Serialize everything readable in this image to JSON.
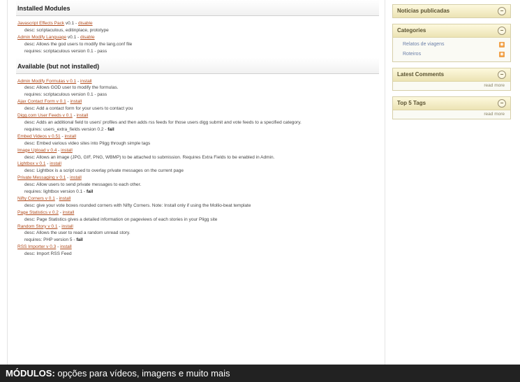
{
  "installed": {
    "heading": "Installed Modules",
    "modules": [
      {
        "name": "Javascript Effects Pack",
        "version": "v0.1",
        "action": "disable",
        "lines": [
          "desc: scriptaculous, editinplace, prototype"
        ]
      },
      {
        "name": "Admin Modify Language",
        "version": "v0.1",
        "action": "disable",
        "lines": [
          "desc: Allows the god users to modify the lang.conf file",
          "requires: scriptaculous version 0.1 - pass"
        ]
      }
    ]
  },
  "available": {
    "heading": "Available (but not installed)",
    "modules": [
      {
        "name": "Admin Modify Formulas v 0.1",
        "action": "install",
        "lines": [
          "desc: Allows GOD user to modify the formulas.",
          "requires: scriptaculous version 0.1 - pass"
        ]
      },
      {
        "name": "Ajax Contact Form v 0.1",
        "action": "install",
        "lines": [
          "desc: Add a contact form for your users to contact you"
        ]
      },
      {
        "name": "Digg.com User Feeds v 0.1",
        "action": "install",
        "lines": [
          "desc: Adds an additional field to users' profiles and then adds rss feeds for those users digg submit and vote feeds to a specified category.",
          "requires: users_extra_fields version 0.2 - fail"
        ]
      },
      {
        "name": "Embed Videos v 0.51",
        "action": "install",
        "lines": [
          "desc: Embed various video sites into Pligg through simple tags"
        ]
      },
      {
        "name": "Image Upload v 0.4",
        "action": "install",
        "lines": [
          "desc: Allows an image (JPG, GIF, PNG, WBMP) to be attached to submission. Requires Extra Fields to be enabled in Admin."
        ]
      },
      {
        "name": "Lightbox v 0.1",
        "action": "install",
        "lines": [
          "desc: Lightbox is a script used to overlay private messages on the current page"
        ]
      },
      {
        "name": "Private Messaging v 0.1",
        "action": "install",
        "lines": [
          "desc: Allow users to send private messages to each other.",
          "requires: lightbox version 0.1 - fail"
        ]
      },
      {
        "name": "Nifty Corners v 0.1",
        "action": "install",
        "lines": [
          "desc: give your vote boxes rounded corners with Nifty Corners. Note: Install only if using the Mollio-beat template"
        ]
      },
      {
        "name": "Page Statistics v 0.2",
        "action": "install",
        "lines": [
          "desc: Page Statistics gives a detailed information on pageviews of each stories in your Pligg site"
        ]
      },
      {
        "name": "Random Story v 0.1",
        "action": "install",
        "lines": [
          "desc: Allows the user to read a random unread story.",
          "requires: PHP version 5 - fail"
        ]
      },
      {
        "name": "RSS Importer v 0.3",
        "action": "install",
        "lines": [
          "desc: Import RSS Feed"
        ]
      }
    ]
  },
  "sidebar": {
    "published": {
      "title": "Noticias publicadas"
    },
    "categories": {
      "title": "Categories",
      "items": [
        "Relatos de viagens",
        "Roteiros"
      ]
    },
    "comments": {
      "title": "Latest Comments",
      "read_more": "read more"
    },
    "tags": {
      "title": "Top 5 Tags",
      "read_more": "read more"
    },
    "toggle_glyph": "−",
    "rss_icon": "rss-icon",
    "colors": {
      "link": "#b04b1c",
      "box_header": "#ece3b4",
      "rss": "#f0a047"
    }
  },
  "caption": {
    "bold": "MÓDULOS:",
    "text": " opções para vídeos, imagens e muito mais"
  }
}
